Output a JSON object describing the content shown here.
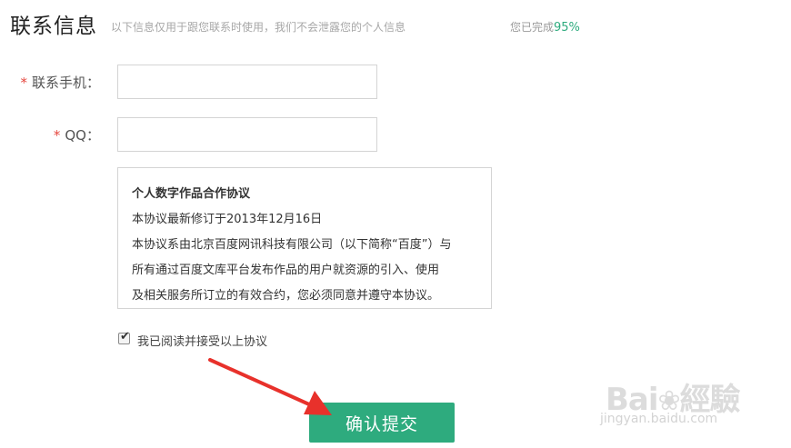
{
  "header": {
    "title": "联系信息",
    "subtitle": "以下信息仅用于跟您联系时使用，我们不会泄露您的个人信息",
    "progress_prefix": "您已完成",
    "progress_value": "95%"
  },
  "form": {
    "required_mark": "*",
    "phone_label": "联系手机：",
    "phone_value": "",
    "qq_label": "QQ：",
    "qq_value": ""
  },
  "agreement": {
    "title": "个人数字作品合作协议",
    "lines": [
      "本协议最新修订于2013年12月16日",
      "本协议系由北京百度网讯科技有限公司（以下简称“百度”）与",
      "所有通过百度文库平台发布作品的用户就资源的引入、使用",
      "及相关服务所订立的有效合约，您必须同意并遵守本协议。"
    ]
  },
  "accept": {
    "checked": true,
    "label": "我已阅读并接受以上协议"
  },
  "submit": {
    "label": "确认提交"
  },
  "watermark": {
    "logo": "Bai經驗",
    "url": "jingyan.baidu.com"
  },
  "colors": {
    "accent": "#2eab7e",
    "required": "#e5473f",
    "arrow": "#e8312b"
  }
}
